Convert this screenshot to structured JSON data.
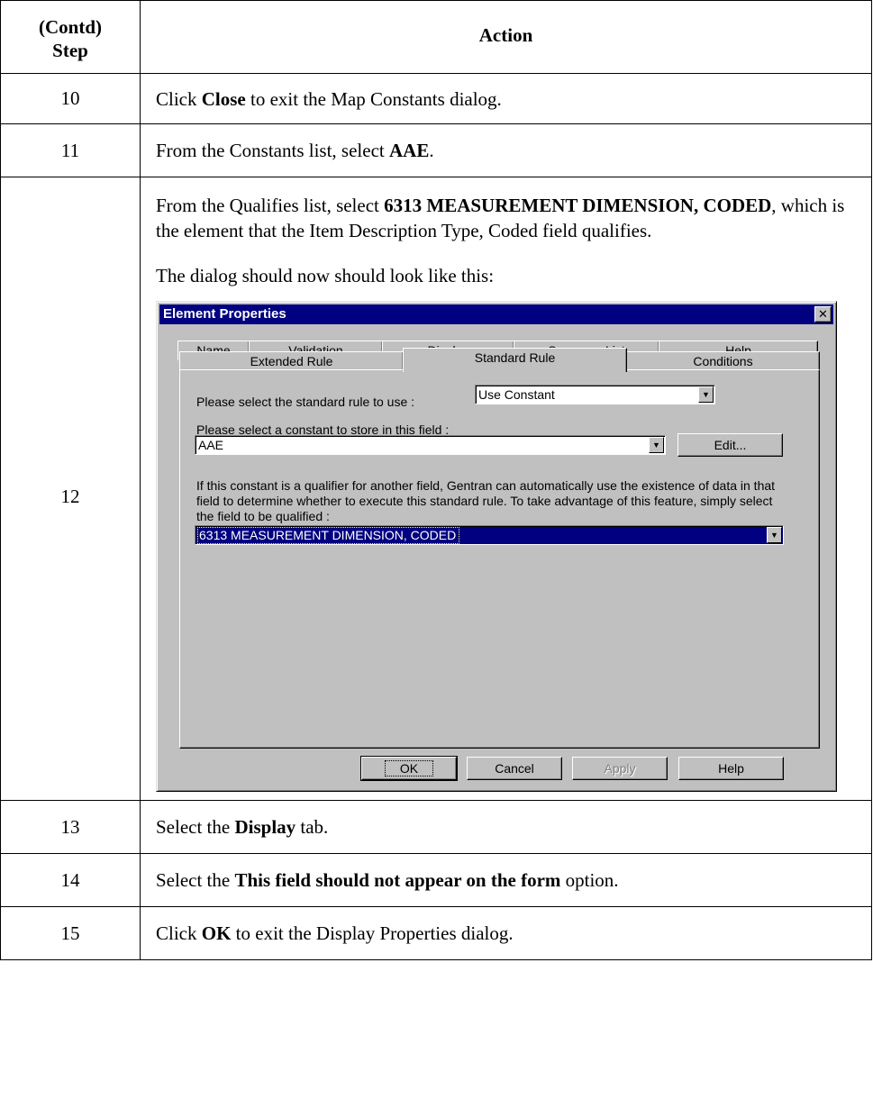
{
  "header": {
    "step_line1": "(Contd)",
    "step_line2": "Step",
    "action": "Action"
  },
  "rows": [
    {
      "step": "10",
      "pre": "Click ",
      "bold": "Close",
      "post": " to exit the Map Constants dialog."
    },
    {
      "step": "11",
      "pre": "From the Constants list, select ",
      "bold": "AAE",
      "post": "."
    },
    {
      "step": "12",
      "pre": "From the Qualifies list, select ",
      "bold": "6313 MEASUREMENT DIMENSION, CODED",
      "post": ", which is the element that the Item Description Type, Coded field qualifies.",
      "note": "The dialog should now should look like this:"
    },
    {
      "step": "13",
      "pre": "Select the ",
      "bold": "Display",
      "post": " tab."
    },
    {
      "step": "14",
      "pre": "Select the ",
      "bold": "This field should not appear on the form",
      "post": " option."
    },
    {
      "step": "15",
      "pre": "Click ",
      "bold": "OK",
      "post": " to exit the Display Properties dialog."
    }
  ],
  "dialog": {
    "title": "Element Properties",
    "close_glyph": "✕",
    "tabs_back": [
      "Name",
      "Validation",
      "Display",
      "Summary List",
      "Help"
    ],
    "tabs_front": [
      "Extended Rule",
      "Standard Rule",
      "Conditions"
    ],
    "active_tab": "Standard Rule",
    "rule_label": "Please select the standard rule to use :",
    "rule_value": "Use Constant",
    "constant_label": "Please select a constant to store in this field :",
    "constant_value": "AAE",
    "edit_button": "Edit...",
    "description": "If this constant is a qualifier for another field, Gentran can automatically use the existence of data in that field to determine whether to execute this standard rule. To take advantage of this feature, simply select the field to be qualified :",
    "qualified_value": "6313 MEASUREMENT DIMENSION, CODED",
    "buttons": {
      "ok": "OK",
      "cancel": "Cancel",
      "apply": "Apply",
      "help": "Help"
    }
  }
}
